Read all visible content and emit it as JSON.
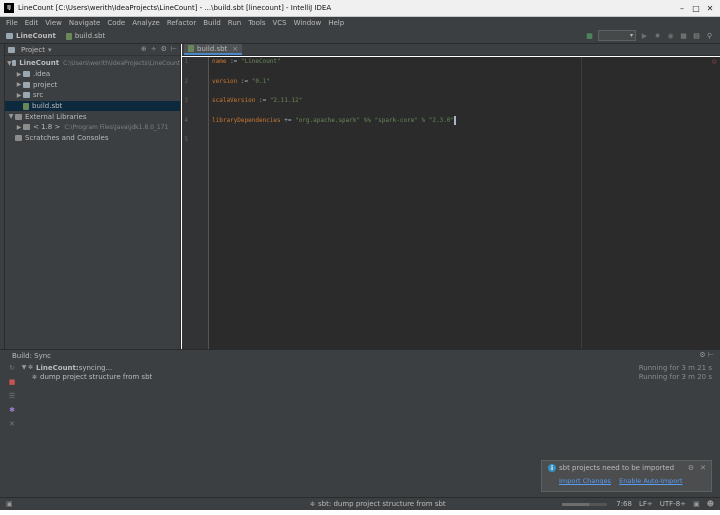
{
  "window": {
    "title": "LineCount [C:\\Users\\werith\\IdeaProjects\\LineCount] - ...\\build.sbt [linecount] - IntelliJ IDEA"
  },
  "menu": [
    "File",
    "Edit",
    "View",
    "Navigate",
    "Code",
    "Analyze",
    "Refactor",
    "Build",
    "Run",
    "Tools",
    "VCS",
    "Window",
    "Help"
  ],
  "nav": {
    "project": "LineCount",
    "file": "build.sbt"
  },
  "project_panel": {
    "label": "Project",
    "tree": [
      {
        "label": "LineCount",
        "path": "C:\\Users\\werith\\IdeaProjects\\LineCount"
      },
      {
        "label": ".idea"
      },
      {
        "label": "project"
      },
      {
        "label": "src"
      },
      {
        "label": "build.sbt"
      },
      {
        "label": "External Libraries"
      },
      {
        "label": "< 1.8 >",
        "path": "C:\\Program Files\\Java\\jdk1.8.0_171"
      },
      {
        "label": "Scratches and Consoles"
      }
    ]
  },
  "editor": {
    "tab": "build.sbt",
    "gutter": [
      "1",
      "2",
      "3",
      "4",
      "5"
    ],
    "lines": [
      {
        "key": "name",
        "op": " := ",
        "val": "\"LineCount\""
      },
      {
        "key": "version",
        "op": " := ",
        "val": "\"0.1\""
      },
      {
        "key": "scalaVersion",
        "op": " := ",
        "val": "\"2.11.12\""
      },
      {
        "key": "libraryDependencies",
        "op": " += ",
        "val": "\"org.apache.spark\" %% \"spark-core\" % \"2.3.0\""
      }
    ]
  },
  "build": {
    "tab_label": "Build: Sync",
    "rows": [
      {
        "label": "LineCount:",
        "status": " syncing...",
        "time": "Running for 3 m 21 s"
      },
      {
        "label": "dump project structure from sbt",
        "time": "Running for 3 m 20 s"
      }
    ]
  },
  "notification": {
    "title": "sbt projects need to be imported",
    "link1": "Import Changes",
    "link2": "Enable Auto-Import"
  },
  "status": {
    "message": "sbt: dump project structure from sbt",
    "position": "7:68",
    "line_sep": "LF÷",
    "encoding": "UTF-8÷"
  }
}
